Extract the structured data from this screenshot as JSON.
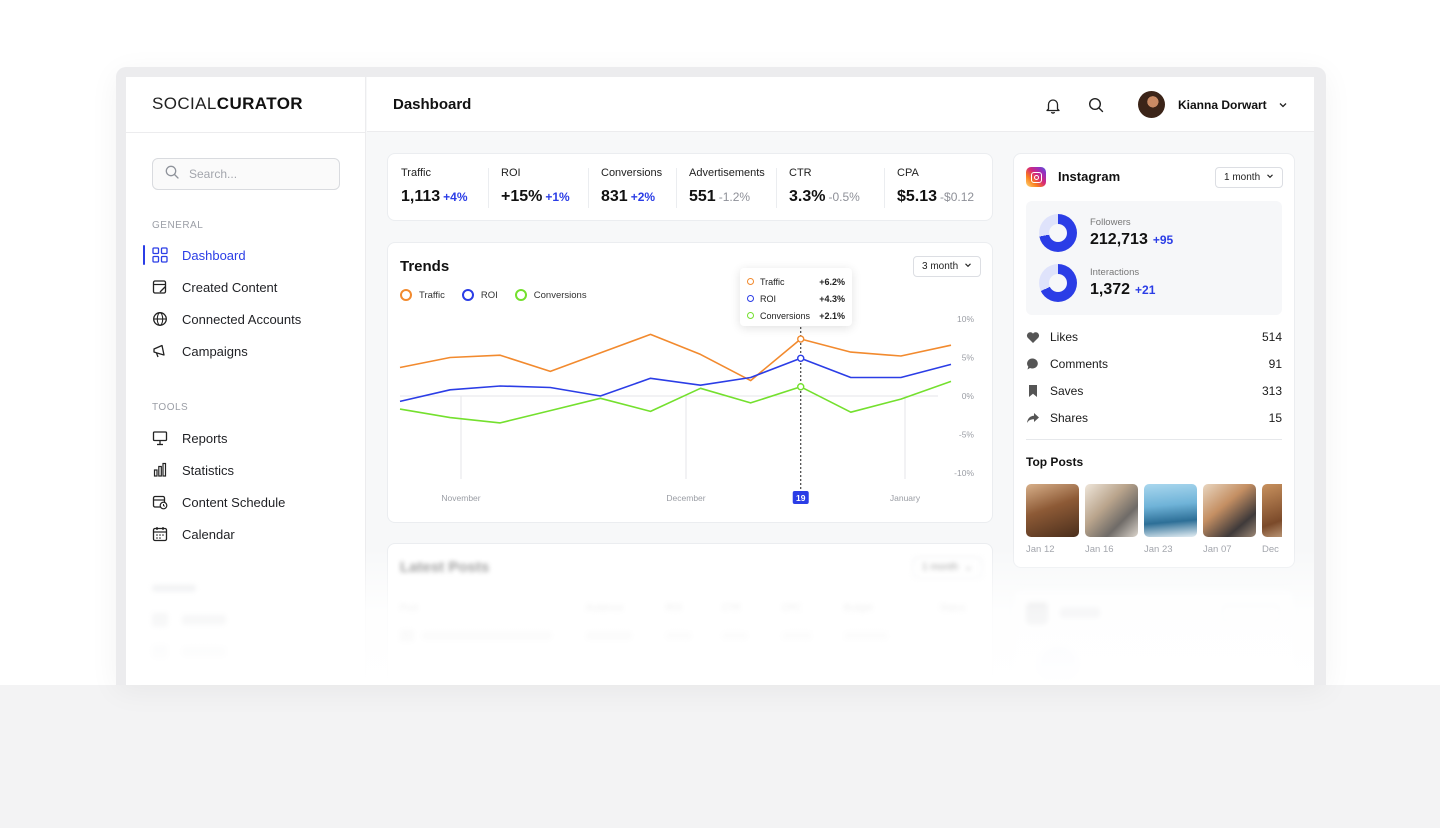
{
  "brand": {
    "part1": "SOCIAL",
    "part2": "CURATOR"
  },
  "search": {
    "placeholder": "Search..."
  },
  "sidebar": {
    "general_label": "GENERAL",
    "general_items": [
      {
        "label": "Dashboard",
        "icon": "grid-icon",
        "active": true
      },
      {
        "label": "Created Content",
        "icon": "edit-document-icon"
      },
      {
        "label": "Connected Accounts",
        "icon": "globe-icon"
      },
      {
        "label": "Campaigns",
        "icon": "megaphone-icon"
      }
    ],
    "tools_label": "TOOLS",
    "tools_items": [
      {
        "label": "Reports",
        "icon": "presentation-icon"
      },
      {
        "label": "Statistics",
        "icon": "bar-chart-icon"
      },
      {
        "label": "Content Schedule",
        "icon": "calendar-clock-icon"
      },
      {
        "label": "Calendar",
        "icon": "calendar-icon"
      }
    ]
  },
  "header": {
    "title": "Dashboard",
    "user_name": "Kianna Dorwart"
  },
  "stats": [
    {
      "label": "Traffic",
      "value": "1,113",
      "delta": "+4%",
      "trend": "up"
    },
    {
      "label": "ROI",
      "value": "+15%",
      "delta": "+1%",
      "trend": "up"
    },
    {
      "label": "Conversions",
      "value": "831",
      "delta": "+2%",
      "trend": "up"
    },
    {
      "label": "Advertisements",
      "value": "551",
      "delta": "-1.2%",
      "trend": "down"
    },
    {
      "label": "CTR",
      "value": "3.3%",
      "delta": "-0.5%",
      "trend": "down"
    },
    {
      "label": "CPA",
      "value": "$5.13",
      "delta": "-$0.12",
      "trend": "down"
    }
  ],
  "trends": {
    "title": "Trends",
    "range": "3 month",
    "tooltip": [
      {
        "name": "Traffic",
        "value": "+6.2%"
      },
      {
        "name": "ROI",
        "value": "+4.3%"
      },
      {
        "name": "Conversions",
        "value": "+2.1%"
      }
    ],
    "highlight_label": "19"
  },
  "chart_data": {
    "type": "line",
    "x_labels": [
      "November",
      "December",
      "January"
    ],
    "y_ticks": [
      "10%",
      "5%",
      "0%",
      "-5%",
      "-10%"
    ],
    "ylim": [
      -10,
      10
    ],
    "series": [
      {
        "name": "Traffic",
        "color": "#f28a2e",
        "values": [
          3.7,
          5.0,
          5.3,
          3.2,
          5.6,
          8.0,
          5.4,
          2.0,
          7.4,
          5.7,
          5.2,
          6.6
        ]
      },
      {
        "name": "ROI",
        "color": "#2b3de6",
        "values": [
          -0.7,
          0.8,
          1.3,
          1.1,
          0.0,
          2.3,
          1.4,
          2.4,
          4.9,
          2.4,
          2.4,
          4.1
        ]
      },
      {
        "name": "Conversions",
        "color": "#74e02e",
        "values": [
          -1.7,
          -2.8,
          -3.5,
          -1.9,
          -0.3,
          -2.0,
          1.0,
          -0.9,
          1.2,
          -2.1,
          -0.4,
          1.9
        ]
      }
    ],
    "highlight_index": 8,
    "legend": "top-left"
  },
  "latest_posts": {
    "title": "Latest Posts",
    "range": "1 month",
    "columns": [
      "Post",
      "Audience",
      "ROI",
      "CTR",
      "CPC",
      "Budget",
      "Status"
    ]
  },
  "instagram": {
    "title": "Instagram",
    "range": "1 month",
    "followers_label": "Followers",
    "followers_value": "212,713",
    "followers_delta": "+95",
    "interactions_label": "Interactions",
    "interactions_value": "1,372",
    "interactions_delta": "+21",
    "engagement": [
      {
        "label": "Likes",
        "value": "514",
        "icon": "heart-icon"
      },
      {
        "label": "Comments",
        "value": "91",
        "icon": "comment-icon"
      },
      {
        "label": "Saves",
        "value": "313",
        "icon": "bookmark-icon"
      },
      {
        "label": "Shares",
        "value": "15",
        "icon": "share-icon"
      }
    ],
    "top_posts_title": "Top Posts",
    "top_posts": [
      {
        "date": "Jan 12"
      },
      {
        "date": "Jan 16"
      },
      {
        "date": "Jan 23"
      },
      {
        "date": "Jan 07"
      },
      {
        "date": "Dec"
      }
    ]
  },
  "colors": {
    "accent": "#2b3de6",
    "traffic": "#f28a2e",
    "conversions": "#74e02e"
  }
}
